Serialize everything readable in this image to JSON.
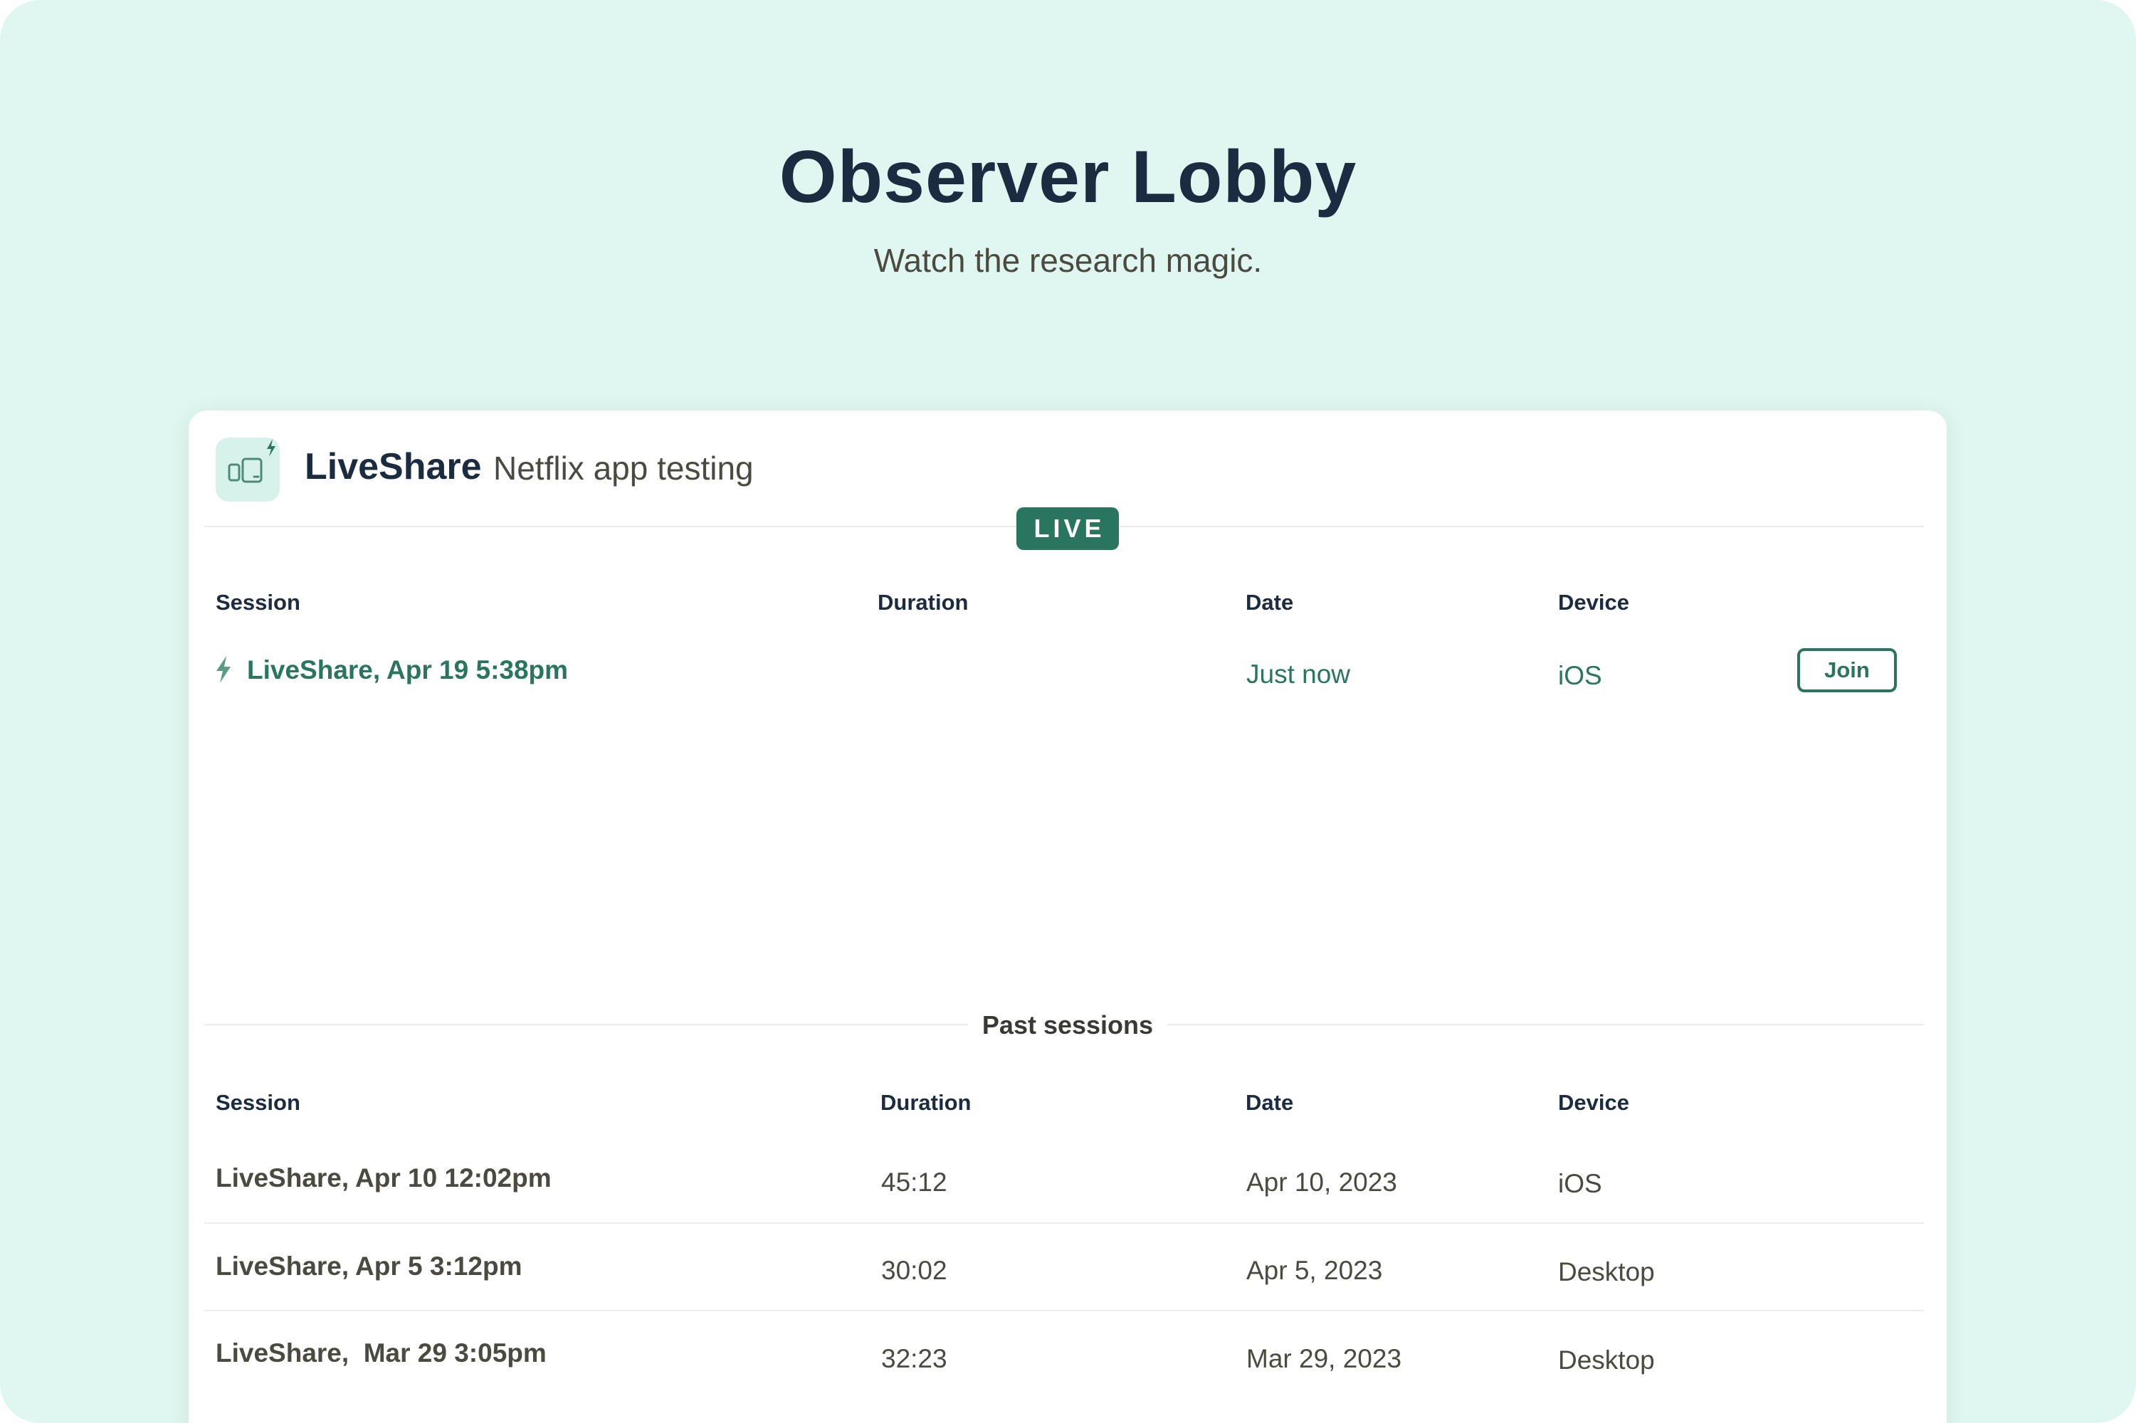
{
  "header": {
    "title": "Observer Lobby",
    "subtitle": "Watch the research magic."
  },
  "project": {
    "icon": "devices-lightning-icon",
    "name": "LiveShare",
    "description": "Netflix app testing"
  },
  "live": {
    "badge": "LIVE",
    "columns": {
      "session": "Session",
      "duration": "Duration",
      "date": "Date",
      "device": "Device"
    },
    "rows": [
      {
        "session": "LiveShare, Apr 19 5:38pm",
        "duration": "",
        "date": "Just now",
        "device": "iOS",
        "action": "Join",
        "icon": "lightning-bolt-icon"
      }
    ]
  },
  "past": {
    "label": "Past sessions",
    "columns": {
      "session": "Session",
      "duration": "Duration",
      "date": "Date",
      "device": "Device"
    },
    "rows": [
      {
        "session": "LiveShare, Apr 10 12:02pm",
        "duration": "45:12",
        "date": "Apr 10, 2023",
        "device": "iOS"
      },
      {
        "session": "LiveShare, Apr 5 3:12pm",
        "duration": "30:02",
        "date": "Apr 5, 2023",
        "device": "Desktop"
      },
      {
        "session": "LiveShare,  Mar 29 3:05pm",
        "duration": "32:23",
        "date": "Mar 29, 2023",
        "device": "Desktop"
      }
    ]
  },
  "colors": {
    "background": "#e0f6f0",
    "accent": "#2a7560",
    "title": "#1b2b40",
    "muted": "#4a4a40"
  }
}
